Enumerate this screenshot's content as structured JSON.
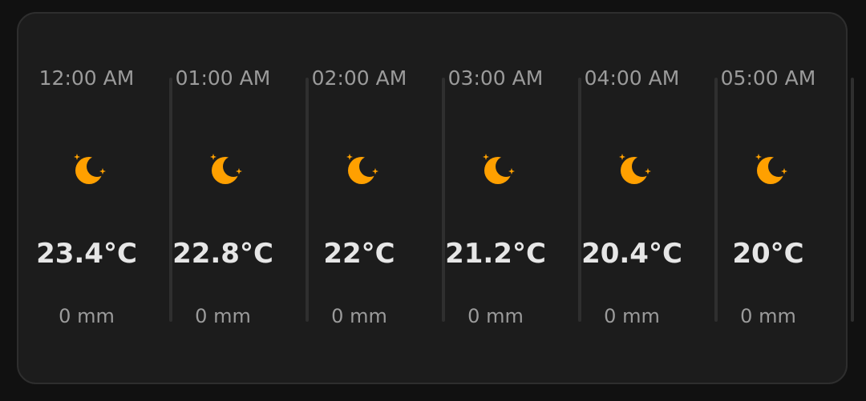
{
  "forecast": {
    "hours": [
      {
        "time": "12:00 AM",
        "icon": "clear-night-icon",
        "temperature": "23.4°C",
        "precipitation": "0 mm"
      },
      {
        "time": "01:00 AM",
        "icon": "clear-night-icon",
        "temperature": "22.8°C",
        "precipitation": "0 mm"
      },
      {
        "time": "02:00 AM",
        "icon": "clear-night-icon",
        "temperature": "22°C",
        "precipitation": "0 mm"
      },
      {
        "time": "03:00 AM",
        "icon": "clear-night-icon",
        "temperature": "21.2°C",
        "precipitation": "0 mm"
      },
      {
        "time": "04:00 AM",
        "icon": "clear-night-icon",
        "temperature": "20.4°C",
        "precipitation": "0 mm"
      },
      {
        "time": "05:00 AM",
        "icon": "clear-night-icon",
        "temperature": "20°C",
        "precipitation": "0 mm"
      }
    ]
  },
  "colors": {
    "background": "#111111",
    "card": "#1c1c1c",
    "icon": "#ffa000",
    "muted_text": "#9b9b9b",
    "primary_text": "#e6e6e6"
  }
}
